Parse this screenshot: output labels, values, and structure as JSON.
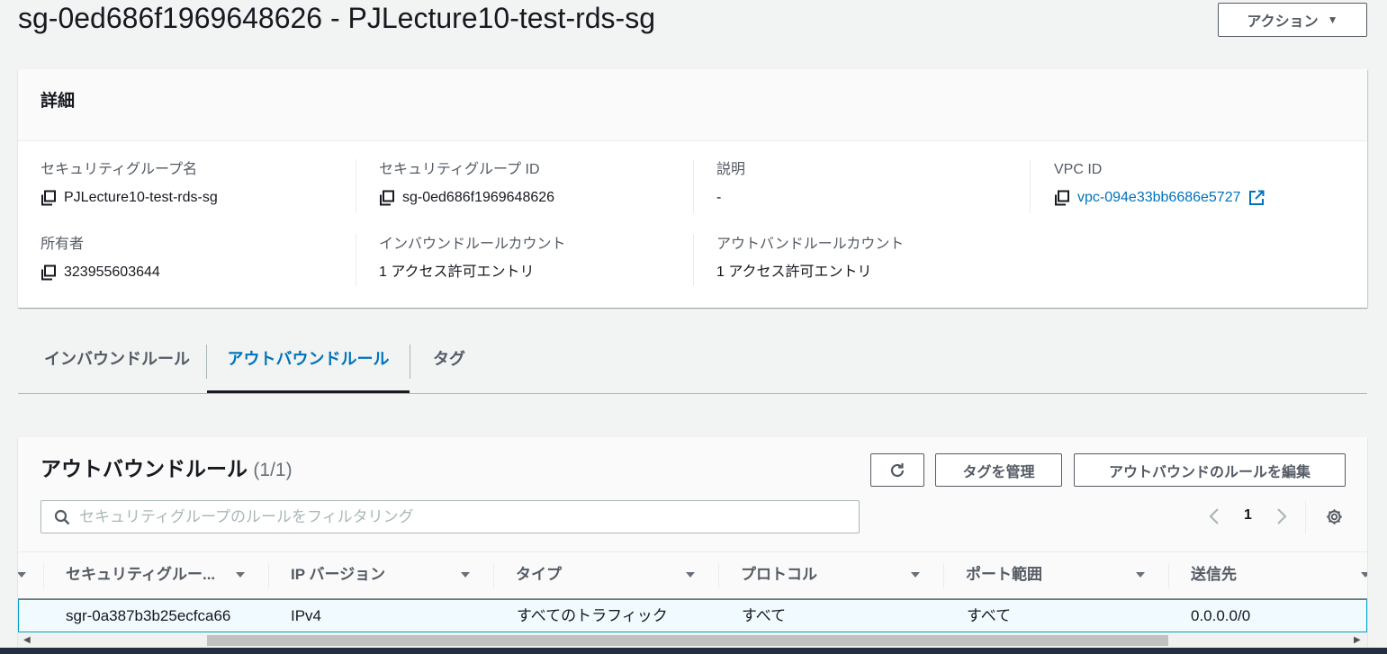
{
  "header": {
    "title": "sg-0ed686f1969648626 - PJLecture10-test-rds-sg",
    "actions_label": "アクション",
    "actions_caret": "▼"
  },
  "details": {
    "heading": "詳細",
    "sg_name_label": "セキュリティグループ名",
    "sg_name_value": "PJLecture10-test-rds-sg",
    "sg_id_label": "セキュリティグループ ID",
    "sg_id_value": "sg-0ed686f1969648626",
    "description_label": "説明",
    "description_value": "-",
    "vpc_id_label": "VPC ID",
    "vpc_id_value": "vpc-094e33bb6686e5727",
    "owner_label": "所有者",
    "owner_value": "323955603644",
    "inbound_count_label": "インバウンドルールカウント",
    "inbound_count_value": "1 アクセス許可エントリ",
    "outbound_count_label": "アウトバンドルールカウント",
    "outbound_count_value": "1 アクセス許可エントリ"
  },
  "tabs": [
    {
      "label": "インバウンドルール",
      "active": false
    },
    {
      "label": "アウトバウンドルール",
      "active": true
    },
    {
      "label": "タグ",
      "active": false
    }
  ],
  "rules": {
    "title": "アウトバウンドルール",
    "count": "(1/1)",
    "refresh_icon": "refresh-icon",
    "manage_tags_label": "タグを管理",
    "edit_rules_label": "アウトバウンドのルールを編集",
    "search_placeholder": "セキュリティグループのルールをフィルタリング",
    "page_number": "1",
    "columns": [
      "セキュリティグルー...",
      "IP バージョン",
      "タイプ",
      "プロトコル",
      "ポート範囲",
      "送信先"
    ],
    "rows": [
      {
        "rule_id": "sgr-0a387b3b25ecfca66",
        "ip_version": "IPv4",
        "type": "すべてのトラフィック",
        "protocol": "すべて",
        "port_range": "すべて",
        "destination": "0.0.0.0/0"
      }
    ]
  },
  "colors": {
    "link": "#0073bb",
    "active_tab": "#0073bb",
    "selected_row_bg": "#f1faff",
    "selected_row_border": "#00a1c9"
  }
}
